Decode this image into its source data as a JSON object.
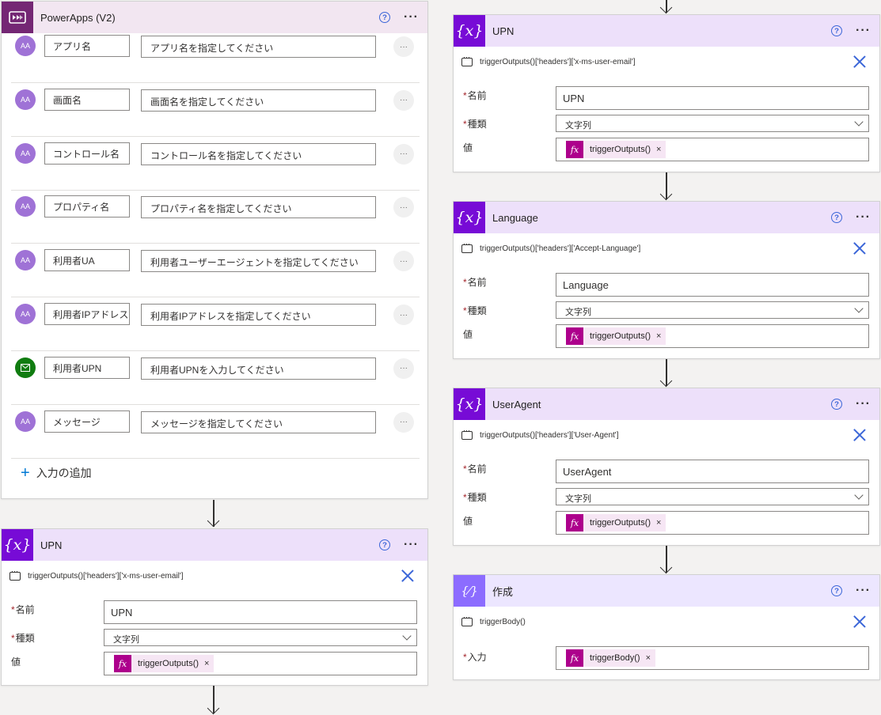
{
  "trigger": {
    "title": "PowerApps (V2)",
    "help": "?",
    "more": "···",
    "type_icon_text": "AA",
    "more_dots": "···",
    "inputs": [
      {
        "name": "アプリ名",
        "description": "アプリ名を指定してください",
        "type_icon": "text-type-icon"
      },
      {
        "name": "画面名",
        "description": "画面名を指定してください",
        "type_icon": "text-type-icon"
      },
      {
        "name": "コントロール名",
        "description": "コントロール名を指定してください",
        "type_icon": "text-type-icon"
      },
      {
        "name": "プロパティ名",
        "description": "プロパティ名を指定してください",
        "type_icon": "text-type-icon"
      },
      {
        "name": "利用者UA",
        "description": "利用者ユーザーエージェントを指定してください",
        "type_icon": "text-type-icon"
      },
      {
        "name": "利用者IPアドレス",
        "description": "利用者IPアドレスを指定してください",
        "type_icon": "text-type-icon"
      },
      {
        "name": "利用者UPN",
        "description": "利用者UPNを入力してください",
        "type_icon": "email-type-icon"
      },
      {
        "name": "メッセージ",
        "description": "メッセージを指定してください",
        "type_icon": "text-type-icon"
      }
    ],
    "add_input_label": "入力の追加",
    "add_input_plus": "+"
  },
  "labels": {
    "name": "名前",
    "type": "種類",
    "value": "値",
    "input": "入力",
    "required_mark": "*",
    "fx": "fx",
    "token_remove": "×"
  },
  "actions": {
    "upn_left": {
      "title": "UPN",
      "icon": "{x}",
      "comment": "triggerOutputs()['headers']['x-ms-user-email']",
      "name_value": "UPN",
      "type_value": "文字列",
      "token": "triggerOutputs()"
    },
    "upn_right": {
      "title": "UPN",
      "icon": "{x}",
      "comment": "triggerOutputs()['headers']['x-ms-user-email']",
      "name_value": "UPN",
      "type_value": "文字列",
      "token": "triggerOutputs()"
    },
    "language": {
      "title": "Language",
      "icon": "{x}",
      "comment": "triggerOutputs()['headers']['Accept-Language']",
      "name_value": "Language",
      "type_value": "文字列",
      "token": "triggerOutputs()"
    },
    "useragent": {
      "title": "UserAgent",
      "icon": "{x}",
      "comment": "triggerOutputs()['headers']['User-Agent']",
      "name_value": "UserAgent",
      "type_value": "文字列",
      "token": "triggerOutputs()"
    },
    "compose": {
      "title": "作成",
      "icon": "{⁄}",
      "comment": "triggerBody()",
      "token": "triggerBody()"
    }
  },
  "colors": {
    "powerapps_icon": "#742774",
    "variable_icon": "#770bd6",
    "compose_icon": "#8c6cff",
    "expression_token": "#ad008c",
    "link_blue": "#3b66d8"
  }
}
